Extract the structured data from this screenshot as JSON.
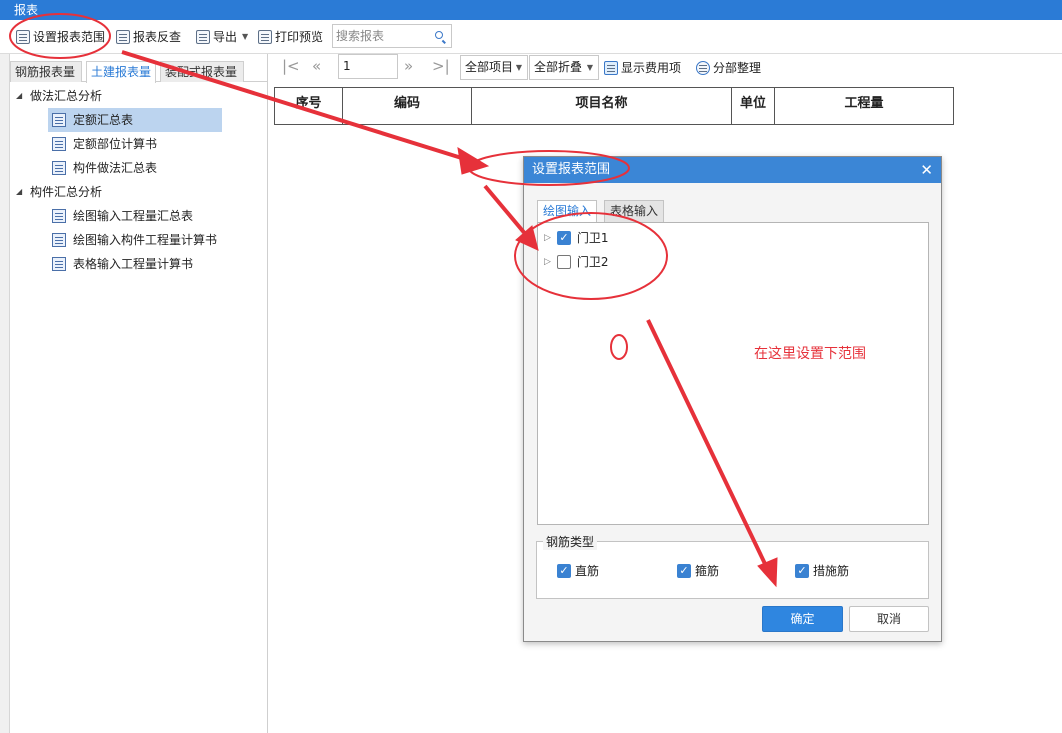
{
  "window": {
    "title": "报表"
  },
  "toolbar": {
    "set_range": "设置报表范围",
    "reverse_check": "报表反查",
    "export": "导出",
    "print_preview": "打印预览",
    "search_placeholder": "搜索报表"
  },
  "left_tabs": [
    "钢筋报表量",
    "土建报表量",
    "装配式报表量"
  ],
  "tree": {
    "group1": {
      "label": "做法汇总分析",
      "items": [
        "定额汇总表",
        "定额部位计算书",
        "构件做法汇总表"
      ]
    },
    "group2": {
      "label": "构件汇总分析",
      "items": [
        "绘图输入工程量汇总表",
        "绘图输入构件工程量计算书",
        "表格输入工程量计算书"
      ]
    }
  },
  "navbar": {
    "page": "1",
    "project_filter": "全部项目",
    "fold": "全部折叠",
    "show_cost": "显示费用项",
    "split_tidy": "分部整理"
  },
  "table": {
    "columns": [
      "序号",
      "编码",
      "项目名称",
      "单位",
      "工程量"
    ]
  },
  "dialog": {
    "title": "设置报表范围",
    "tabs": [
      "绘图输入",
      "表格输入"
    ],
    "items": [
      {
        "label": "门卫1",
        "checked": true
      },
      {
        "label": "门卫2",
        "checked": false
      }
    ],
    "rebar_type_legend": "钢筋类型",
    "rebar_types": [
      {
        "label": "直筋",
        "checked": true
      },
      {
        "label": "箍筋",
        "checked": true
      },
      {
        "label": "措施筋",
        "checked": true
      }
    ],
    "ok": "确定",
    "cancel": "取消"
  },
  "annotation": {
    "note": "在这里设置下范围",
    "color": "#e6313a"
  },
  "colors": {
    "accent": "#2b7bd6",
    "selection": "#bcd4ef",
    "primary_button": "#2f86e0"
  }
}
